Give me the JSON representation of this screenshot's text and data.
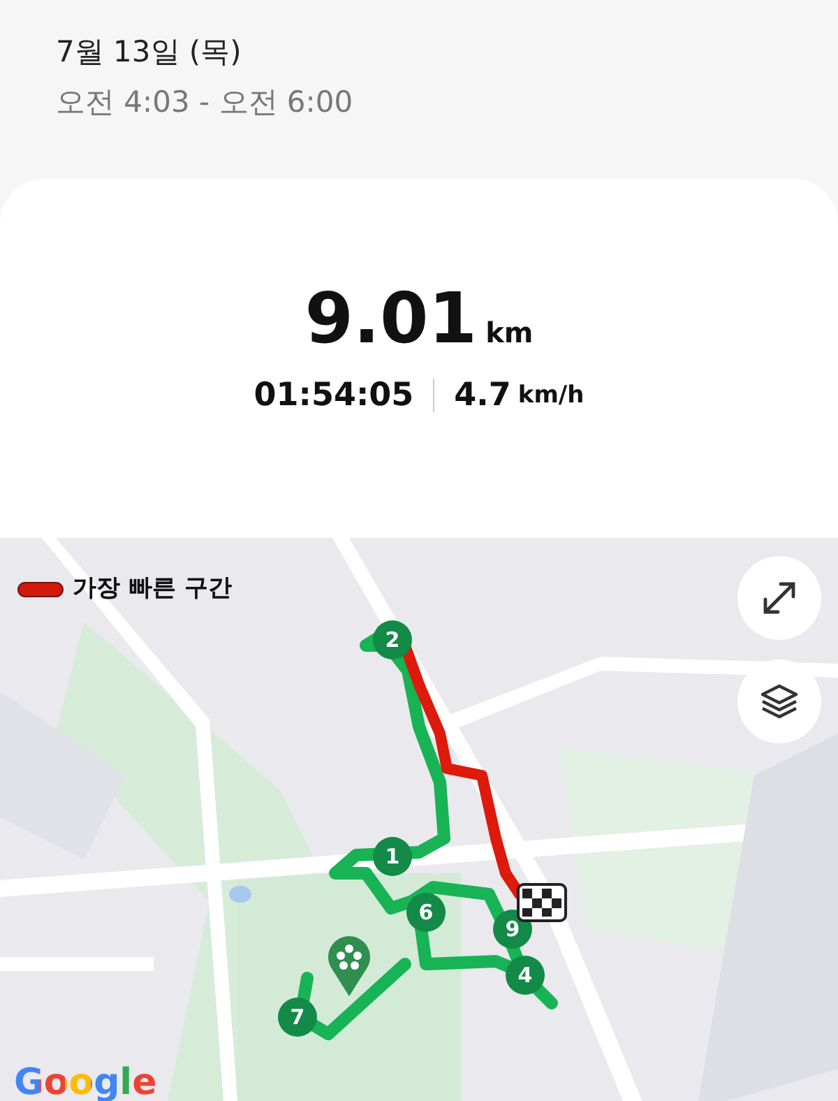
{
  "header": {
    "date": "7월 13일 (목)",
    "time_range": "오전 4:03 - 오전 6:00"
  },
  "summary": {
    "distance": "9.01",
    "distance_unit": "km",
    "duration": "01:54:05",
    "speed": "4.7",
    "speed_unit": "km/h"
  },
  "map": {
    "legend": "가장 빠른 구간",
    "markers": [
      {
        "label": "2"
      },
      {
        "label": "1"
      },
      {
        "label": "6"
      },
      {
        "label": "9"
      },
      {
        "label": "4"
      },
      {
        "label": "7"
      }
    ],
    "attribution": "Google"
  }
}
